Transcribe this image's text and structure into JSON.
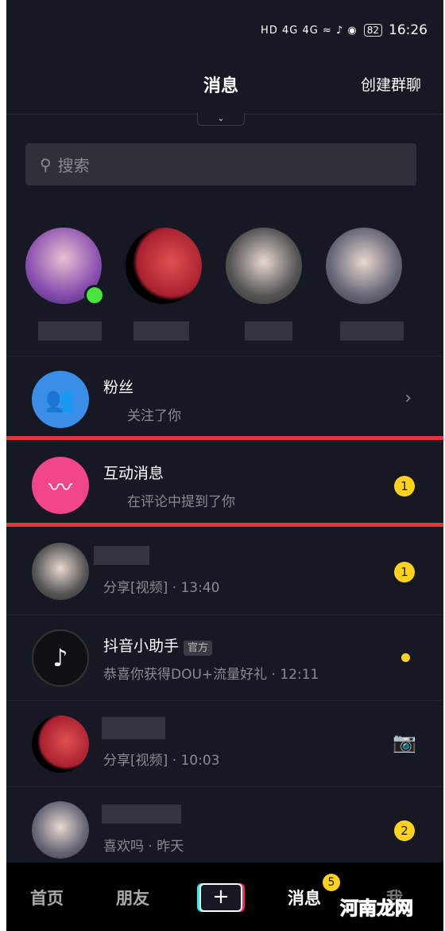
{
  "status": {
    "icons": "HD 4G 4G ≈ ♪ ◉",
    "battery": "82",
    "time": "16:26"
  },
  "header": {
    "title": "消息",
    "create_group": "创建群聊",
    "pull_icon": "chevron-down-icon"
  },
  "search": {
    "placeholder": "搜索"
  },
  "rows": [
    {
      "name": "粉丝",
      "sub": "关注了你"
    },
    {
      "name": "互动消息",
      "sub": "在评论中提到了你",
      "badge": "1"
    },
    {
      "name": "",
      "sub": "分享[视频] · 13:40",
      "badge": "1"
    },
    {
      "name": "抖音小助手",
      "tag": "官方",
      "sub": "恭喜你获得DOU+流量好礼 · 12:11"
    },
    {
      "name": "",
      "sub": "分享[视频] · 10:03"
    },
    {
      "name": "",
      "sub": "喜欢吗 · 昨天",
      "badge": "2"
    }
  ],
  "tabbar": {
    "home": "首页",
    "friends": "朋友",
    "plus": "+",
    "messages": "消息",
    "messages_badge": "5",
    "me": "我"
  },
  "watermark": "河南龙网",
  "colors": {
    "background": "#161823",
    "badge": "#fdd21e",
    "highlight": "#e8333a"
  }
}
